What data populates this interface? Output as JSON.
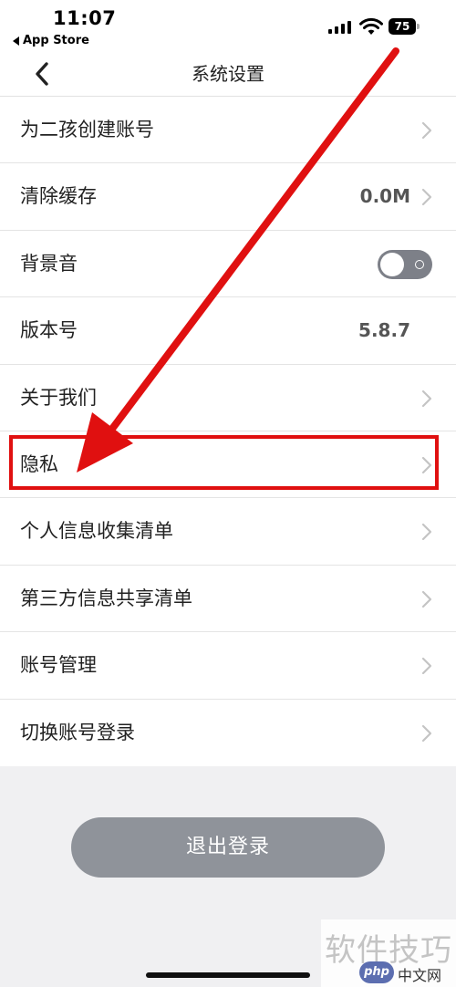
{
  "status_bar": {
    "time": "11:07",
    "back_app": "App Store",
    "battery": "75",
    "icons": [
      "signal-icon",
      "wifi-icon",
      "battery-icon"
    ]
  },
  "nav": {
    "title": "系统设置",
    "back_icon": "chevron-left-icon"
  },
  "settings": {
    "rows": [
      {
        "label": "为二孩创建账号",
        "kind": "chevron"
      },
      {
        "label": "清除缓存",
        "value": "0.0M",
        "kind": "value-chevron"
      },
      {
        "label": "背景音",
        "kind": "toggle",
        "toggle_on": false
      },
      {
        "label": "版本号",
        "value": "5.8.7",
        "kind": "value"
      },
      {
        "label": "关于我们",
        "kind": "chevron"
      },
      {
        "label": "隐私",
        "kind": "chevron",
        "highlighted": true
      },
      {
        "label": "个人信息收集清单",
        "kind": "chevron"
      },
      {
        "label": "第三方信息共享清单",
        "kind": "chevron"
      },
      {
        "label": "账号管理",
        "kind": "chevron"
      },
      {
        "label": "切换账号登录",
        "kind": "chevron"
      }
    ]
  },
  "logout": {
    "label": "退出登录"
  },
  "watermark": {
    "main": "软件技巧",
    "badge": "php",
    "sub": "中文网"
  },
  "colors": {
    "annotation": "#e01010",
    "logout_bg": "#8f939a",
    "page_bg": "#f0f0f2",
    "toggle_off": "#7d8088"
  }
}
